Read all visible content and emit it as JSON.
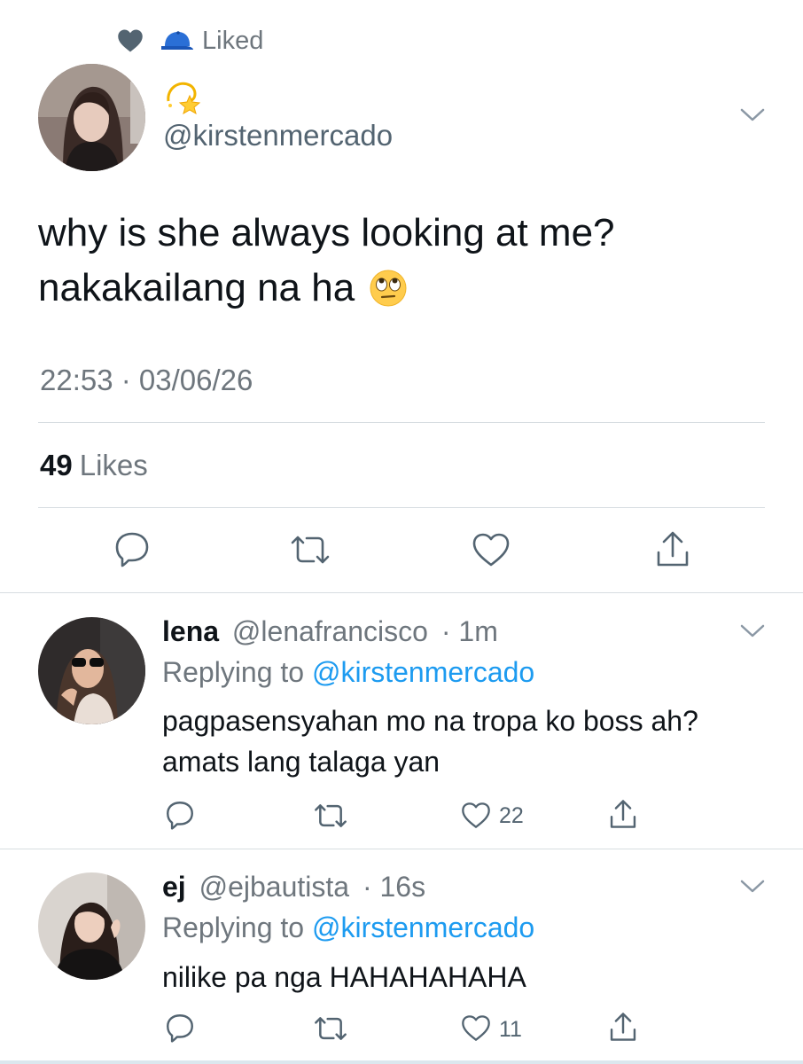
{
  "header": {
    "liked_label": "Liked",
    "liked_icons": [
      "heart-icon",
      "blue-cap-icon"
    ]
  },
  "tweet": {
    "display_emoji": "dizzy-star-emoji",
    "handle": "@kirstenmercado",
    "text_line1": "why is she always looking at me?",
    "text_line2": "nakakailang na ha",
    "text_emoji": "eye-roll-emoji",
    "timestamp": "22:53 · 03/06/26",
    "likes_count": "49",
    "likes_label": "Likes",
    "actions": [
      "reply-icon",
      "retweet-icon",
      "like-icon",
      "share-icon"
    ]
  },
  "replies": [
    {
      "name": "lena",
      "handle": "@lenafrancisco",
      "time": "· 1m",
      "replying_prefix": "Replying to",
      "replying_to": "@kirstenmercado",
      "text_line1": "pagpasensyahan mo na tropa ko boss ah?",
      "text_line2": "amats lang talaga yan",
      "like_count": "22"
    },
    {
      "name": "ej",
      "handle": "@ejbautista",
      "time": "· 16s",
      "replying_prefix": "Replying to",
      "replying_to": "@kirstenmercado",
      "text_line1": "nilike pa nga HAHAHAHAHA",
      "text_line2": "",
      "like_count": "11"
    }
  ],
  "colors": {
    "accent": "#1d9bf0",
    "secondary_text": "#6e767d",
    "divider": "#d7dde1"
  }
}
